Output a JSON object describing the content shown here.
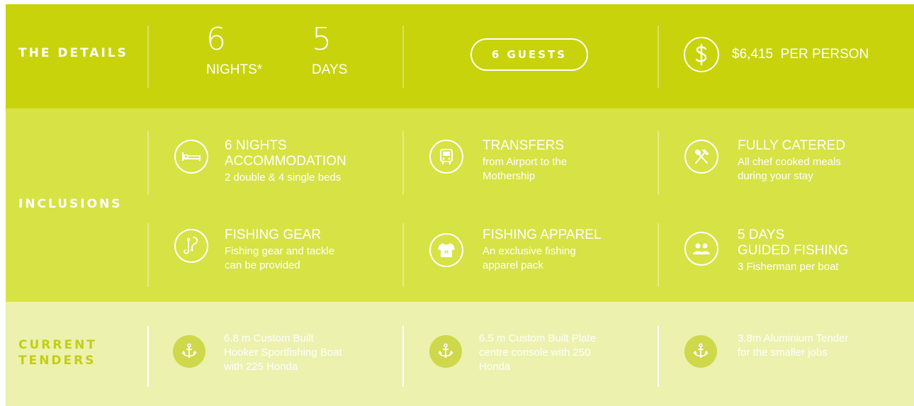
{
  "details": {
    "label": "THE DETAILS",
    "nights_num": "6",
    "nights_label": "NIGHTS*",
    "days_num": "5",
    "days_label": "DAYS",
    "guests": "6 GUESTS",
    "price_icon": "dollar-icon",
    "price": "$6,415  PER PERSON"
  },
  "inclusions": {
    "label": "INCLUSIONS",
    "items": [
      {
        "icon": "bed-icon",
        "title_lines": [
          "6 NIGHTS",
          "ACCOMMODATION"
        ],
        "sub_lines": [
          "2 double & 4 single beds"
        ]
      },
      {
        "icon": "bus-icon",
        "title_lines": [
          "TRANSFERS"
        ],
        "sub_lines": [
          "from Airport to the",
          "Mothership"
        ]
      },
      {
        "icon": "cutlery-icon",
        "title_lines": [
          "FULLY CATERED"
        ],
        "sub_lines": [
          "All chef cooked meals",
          "during your stay"
        ]
      },
      {
        "icon": "fishing-hook-icon",
        "title_lines": [
          "FISHING GEAR"
        ],
        "sub_lines": [
          "Fishing gear and tackle",
          "can be provided"
        ]
      },
      {
        "icon": "tshirt-icon",
        "title_lines": [
          "FISHING APPAREL"
        ],
        "sub_lines": [
          "An exclusive fishing",
          "apparel pack"
        ]
      },
      {
        "icon": "people-icon",
        "title_lines": [
          "5 DAYS",
          "GUIDED FISHING"
        ],
        "sub_lines": [
          "3 Fisherman per boat"
        ]
      }
    ]
  },
  "tenders": {
    "label_lines": [
      "CURRENT",
      "TENDERS"
    ],
    "items": [
      {
        "icon": "anchor-icon",
        "lines": [
          "6.8 m Custom Built",
          "Hooker Sportfishing Boat",
          "with 225 Honda"
        ]
      },
      {
        "icon": "anchor-icon",
        "lines": [
          "6.5 m Custom Built Plate",
          "centre console with 250",
          "Honda"
        ]
      },
      {
        "icon": "anchor-icon",
        "lines": [
          "3.8m Aluminium Tender",
          "for the smaller jobs"
        ]
      }
    ]
  },
  "colors": {
    "details_bg": "#c8d30c",
    "inclusions_bg": "#d7e245",
    "tenders_bg": "#ecf1ae",
    "tenders_label": "#c3ce12",
    "tender_icon_bg": "#ced84a"
  }
}
